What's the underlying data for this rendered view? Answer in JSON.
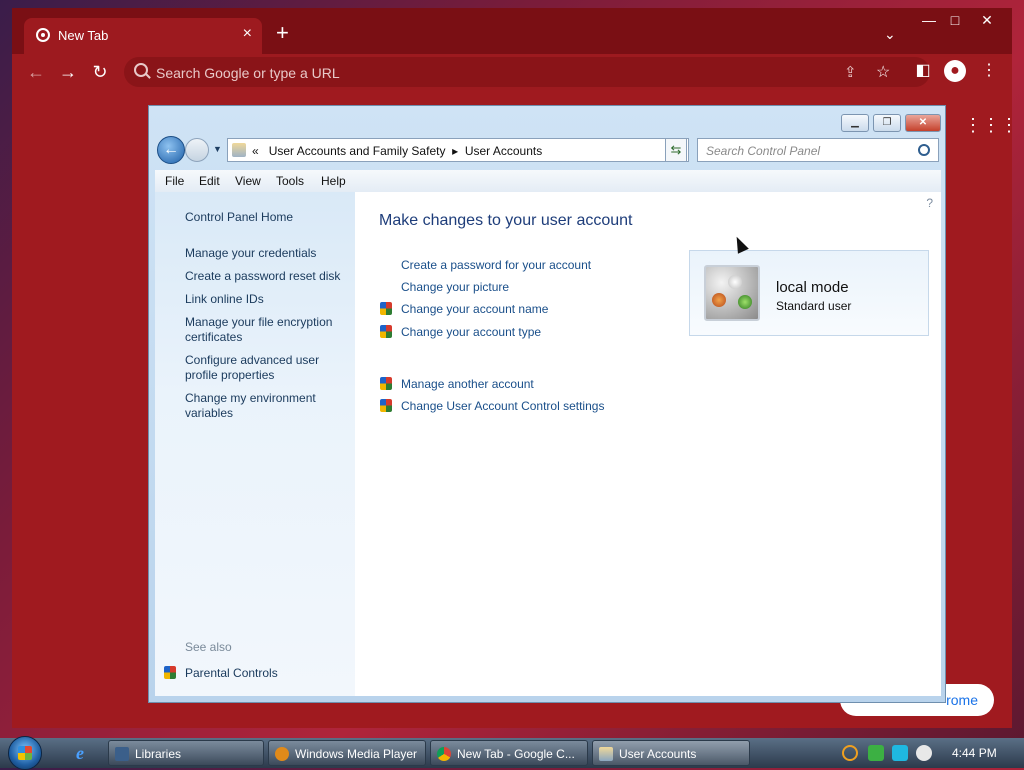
{
  "chrome": {
    "tab_title": "New Tab",
    "tab_close": "×",
    "new_tab": "+",
    "omnibox_placeholder": "Search Google or type a URL",
    "customize_label": "rome",
    "win_min": "—",
    "win_max": "□",
    "win_close": "✕"
  },
  "control_panel": {
    "breadcrumb_prefix": "«",
    "breadcrumb_1": "User Accounts and Family Safety",
    "breadcrumb_sep": "▸",
    "breadcrumb_2": "User Accounts",
    "search_placeholder": "Search Control Panel",
    "menu": [
      "File",
      "Edit",
      "View",
      "Tools",
      "Help"
    ],
    "left_links": [
      "Control Panel Home",
      "Manage your credentials",
      "Create a password reset disk",
      "Link online IDs",
      "Manage your file encryption certificates",
      "Configure advanced user profile properties",
      "Change my environment variables"
    ],
    "see_also_label": "See also",
    "see_also_links": [
      "Parental Controls"
    ],
    "heading": "Make changes to your user account",
    "tasks": [
      "Create a password for your account",
      "Change your picture",
      "Change your account name",
      "Change your account type"
    ],
    "tasks2": [
      "Manage another account",
      "Change User Account Control settings"
    ],
    "account": {
      "name": "local mode",
      "type": "Standard user"
    }
  },
  "taskbar": {
    "buttons": [
      "Libraries",
      "Windows Media Player",
      "New Tab - Google C...",
      "User Accounts"
    ],
    "clock": "4:44 PM"
  }
}
